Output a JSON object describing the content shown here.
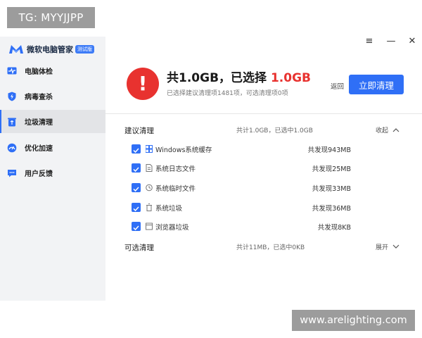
{
  "watermark_top": "TG: MYYJJPP",
  "watermark_bottom": "www.arelighting.com",
  "brand": {
    "name": "微软电脑管家",
    "badge": "测试版"
  },
  "nav": [
    {
      "label": "电脑体检",
      "icon": "pulse-monitor-icon"
    },
    {
      "label": "病毒查杀",
      "icon": "shield-bolt-icon"
    },
    {
      "label": "垃圾清理",
      "icon": "trash-icon",
      "active": true
    },
    {
      "label": "优化加速",
      "icon": "speedometer-icon"
    },
    {
      "label": "用户反馈",
      "icon": "chat-bubble-icon"
    }
  ],
  "window_controls": {
    "menu": "≡",
    "minimize": "—",
    "close": "✕"
  },
  "summary": {
    "alert_icon": "!",
    "prefix": "共1.0GB，已选择 ",
    "selected": "1.0GB",
    "detail": "已选择建议清理项1481项，可选清理项0项",
    "back_label": "返回",
    "clean_button": "立即清理"
  },
  "recommended": {
    "title": "建议清理",
    "summary": "共计1.0GB，已选中1.0GB",
    "toggle": "收起",
    "items": [
      {
        "label": "Windows系统缓存",
        "size": "共发现943MB",
        "checked": true,
        "icon": "windows-icon"
      },
      {
        "label": "系统日志文件",
        "size": "共发现25MB",
        "checked": true,
        "icon": "document-icon"
      },
      {
        "label": "系统临时文件",
        "size": "共发现33MB",
        "checked": true,
        "icon": "clock-icon"
      },
      {
        "label": "系统垃圾",
        "size": "共发现36MB",
        "checked": true,
        "icon": "bin-icon"
      },
      {
        "label": "浏览器垃圾",
        "size": "共发现8KB",
        "checked": true,
        "icon": "browser-icon"
      }
    ]
  },
  "optional": {
    "title": "可选清理",
    "summary": "共计11MB，已选中0KB",
    "toggle": "展开"
  },
  "colors": {
    "accent": "#2f6ff6",
    "danger": "#e8322f"
  }
}
